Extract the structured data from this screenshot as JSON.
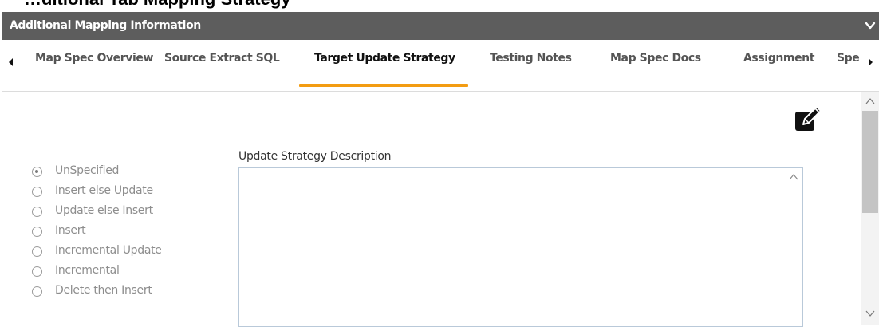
{
  "page_heading": "…ditional Tab Mapping Strategy",
  "panel": {
    "title": "Additional Mapping Information"
  },
  "tabs": [
    {
      "label": "Map Spec Overview",
      "active": false
    },
    {
      "label": "Source Extract SQL",
      "active": false
    },
    {
      "label": "Target Update Strategy",
      "active": true
    },
    {
      "label": "Testing Notes",
      "active": false
    },
    {
      "label": "Map Spec Docs",
      "active": false
    },
    {
      "label": "Assignment",
      "active": false
    },
    {
      "label": "Spe",
      "active": false
    }
  ],
  "update_strategy": {
    "description_label": "Update Strategy Description",
    "description_value": "",
    "options": [
      {
        "label": "UnSpecified",
        "checked": true
      },
      {
        "label": "Insert else Update",
        "checked": false
      },
      {
        "label": "Update else Insert",
        "checked": false
      },
      {
        "label": "Insert",
        "checked": false
      },
      {
        "label": "Incremental Update",
        "checked": false
      },
      {
        "label": "Incremental",
        "checked": false
      },
      {
        "label": "Delete then Insert",
        "checked": false
      }
    ]
  },
  "colors": {
    "header_bg": "#5d5d5d",
    "active_tab_underline": "#f39c12",
    "textarea_border": "#b9c9d9"
  },
  "icons": {
    "edit": "pencil-square-icon",
    "collapse": "chevron-down-icon",
    "tab_prev": "caret-left-icon",
    "tab_next": "caret-right-icon"
  }
}
